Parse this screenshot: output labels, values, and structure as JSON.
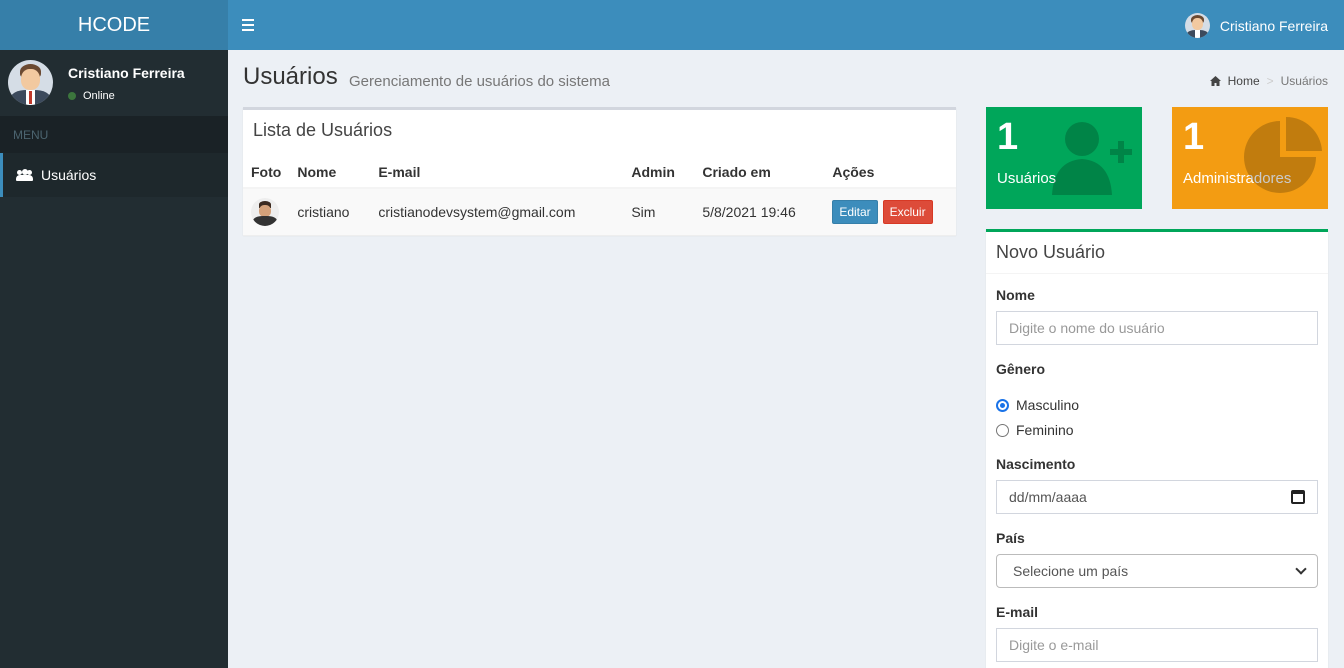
{
  "header": {
    "logo": "HCODE",
    "user_name": "Cristiano Ferreira"
  },
  "sidebar": {
    "user_name": "Cristiano Ferreira",
    "status": "Online",
    "menu_header": "MENU",
    "items": [
      {
        "label": "Usuários",
        "icon": "users-icon",
        "active": true
      }
    ]
  },
  "page": {
    "title": "Usuários",
    "subtitle": "Gerenciamento de usuários do sistema",
    "breadcrumb": {
      "home": "Home",
      "current": "Usuários"
    }
  },
  "user_list": {
    "title": "Lista de Usuários",
    "columns": [
      "Foto",
      "Nome",
      "E-mail",
      "Admin",
      "Criado em",
      "Ações"
    ],
    "rows": [
      {
        "name": "cristiano",
        "email": "cristianodevsystem@gmail.com",
        "admin": "Sim",
        "created": "5/8/2021 19:46",
        "edit_label": "Editar",
        "delete_label": "Excluir"
      }
    ]
  },
  "stats": {
    "users": {
      "count": "1",
      "label": "Usuários",
      "color": "#00a65a",
      "icon": "user-plus-icon"
    },
    "admins": {
      "count": "1",
      "label": "Administradores",
      "color": "#f39c12",
      "icon": "pie-chart-icon"
    }
  },
  "new_user_form": {
    "title": "Novo Usuário",
    "name_label": "Nome",
    "name_placeholder": "Digite o nome do usuário",
    "gender_label": "Gênero",
    "gender_options": [
      "Masculino",
      "Feminino"
    ],
    "gender_selected": "Masculino",
    "birth_label": "Nascimento",
    "birth_placeholder": "dd/mm/aaaa",
    "country_label": "País",
    "country_selected": "Selecione um país",
    "email_label": "E-mail",
    "email_placeholder": "Digite o e-mail"
  },
  "colors": {
    "header": "#3c8dbc",
    "logo_bg": "#367fa9",
    "sidebar": "#222d32",
    "content_bg": "#ecf0f5",
    "edit_button": "#3c8dbc",
    "delete_button": "#dd4b39"
  }
}
